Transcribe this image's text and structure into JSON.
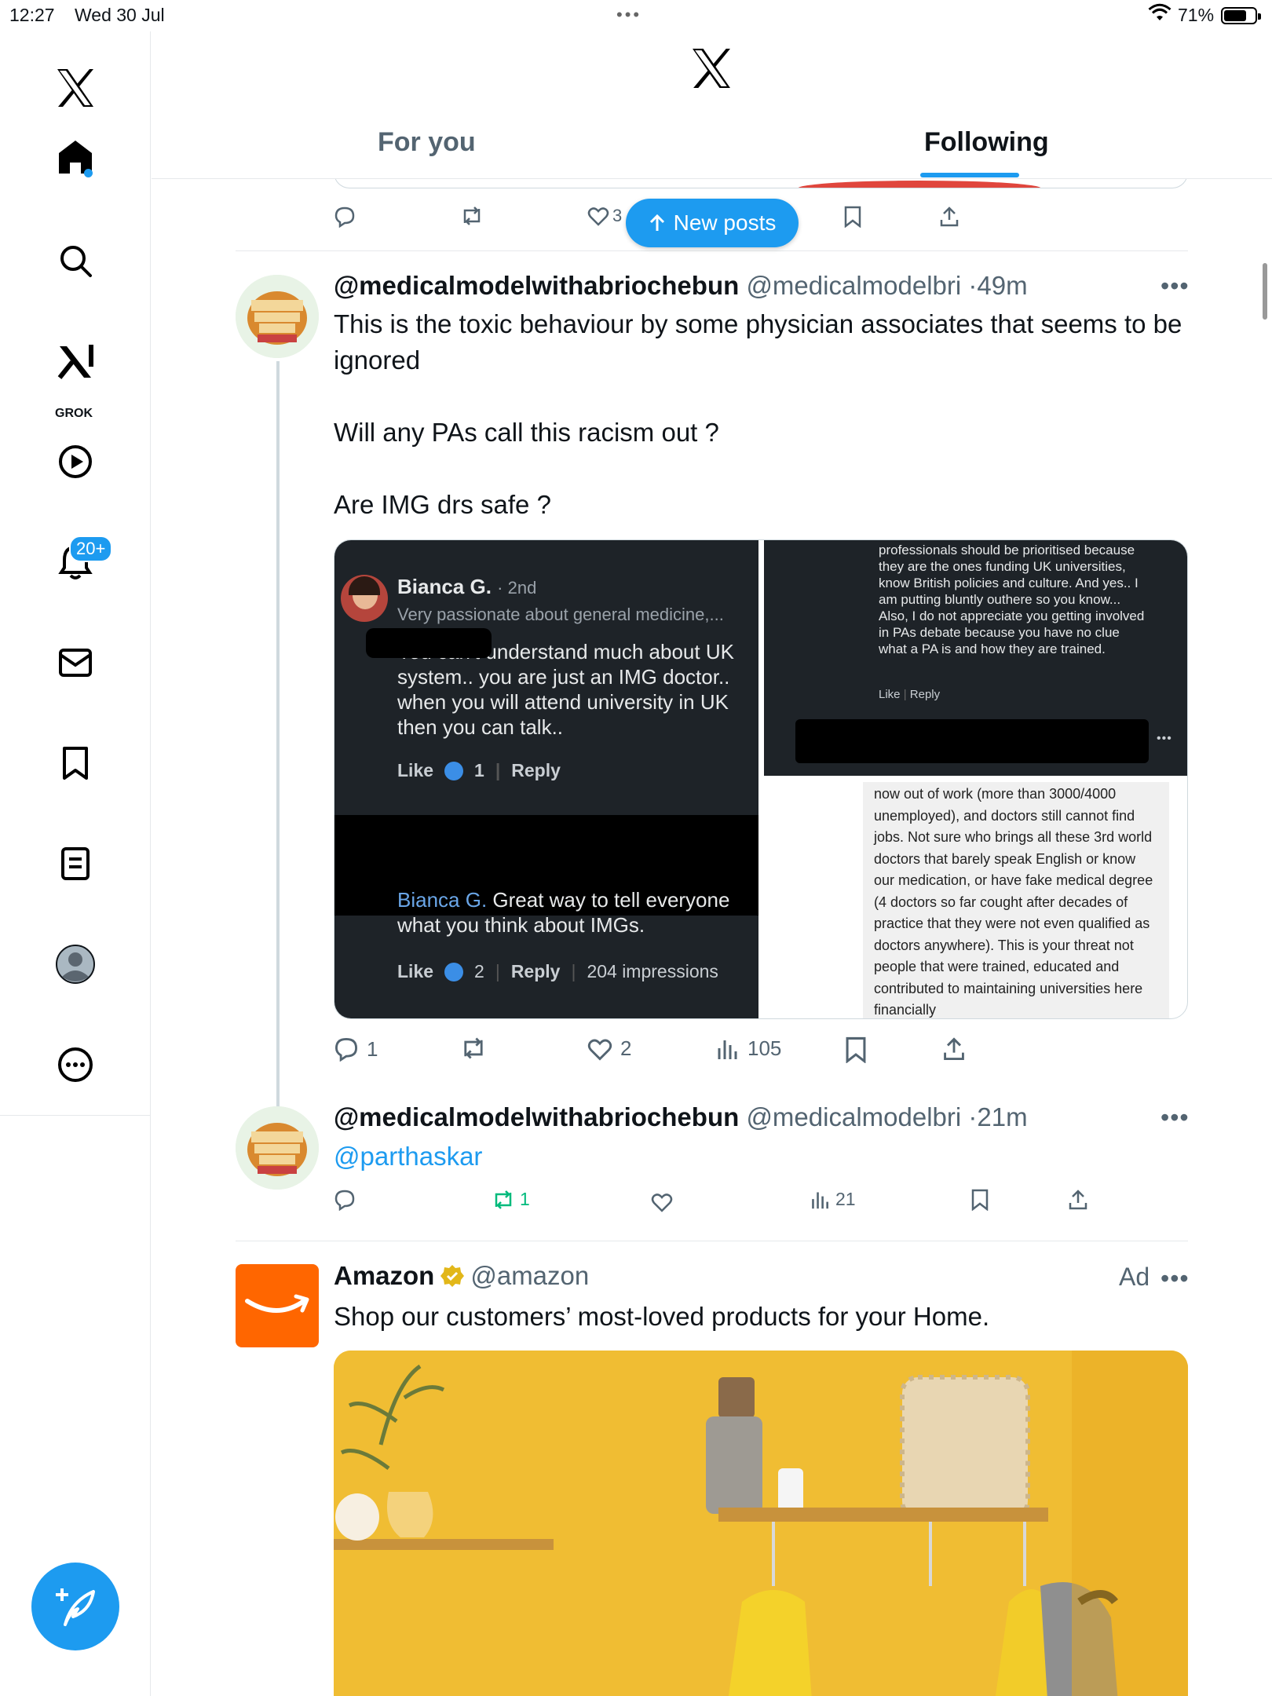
{
  "status_bar": {
    "time": "12:27",
    "date": "Wed 30 Jul",
    "battery": "71%",
    "battery_level": 0.71
  },
  "sidebar": {
    "grok_label": "GROK",
    "notifications_badge": "20+",
    "items": [
      "x-logo",
      "home",
      "search",
      "grok",
      "video",
      "notifications",
      "messages",
      "bookmarks",
      "lists",
      "profile",
      "more"
    ]
  },
  "header": {
    "tabs": [
      {
        "label": "For you",
        "active": false
      },
      {
        "label": "Following",
        "active": true
      }
    ]
  },
  "prev_post": {
    "like_count": "3"
  },
  "new_posts_label": "New posts",
  "posts": [
    {
      "name": "@medicalmodelwithabriochebun",
      "handle": "@medicalmodelbri",
      "time": "49m",
      "lines": [
        "This is the toxic behaviour by some physician associates that seems to be ignored",
        "Will any PAs call this racism out ?",
        "Are IMG drs safe ?"
      ],
      "media": {
        "left": {
          "commenter": "Bianca G.",
          "degree": "· 2nd",
          "headline": "Very passionate about general medicine,...",
          "comment1": "You can't understand much about UK system.. you are just an IMG doctor.. when you will attend university in UK then you can talk..",
          "like": "Like",
          "reply": "Reply",
          "count1": "1",
          "reply_name": "Bianca G.",
          "comment2": "Great way to tell everyone what you think about IMGs.",
          "count2": "2",
          "impressions": "204 impressions"
        },
        "right_top": {
          "text": "professionals should be prioritised because they are the ones funding UK universities, know British policies and culture. And yes.. I am putting bluntly outhere so you know... Also, I do not appreciate you getting involved in PAs debate because you have no clue what a PA is and how they are trained.",
          "like": "Like",
          "reply": "Reply"
        },
        "right_bottom": {
          "text": "now out of work (more than 3000/4000 unemployed), and doctors still cannot find jobs. Not sure who brings all these 3rd world doctors that barely speak English or know our medication, or have fake medical degree (4 doctors so far cought after decades of practice that they were not even qualified as doctors anywhere). This is your threat not people that were trained, educated and contributed to maintaining universities here financially"
        }
      },
      "stats": {
        "replies": "1",
        "reposts": "",
        "likes": "2",
        "views": "105"
      }
    },
    {
      "name": "@medicalmodelwithabriochebun",
      "handle": "@medicalmodelbri",
      "time": "21m",
      "mention": "@parthaskar",
      "stats": {
        "replies": "",
        "reposts": "1",
        "likes": "",
        "views": "21"
      }
    }
  ],
  "ad": {
    "name": "Amazon",
    "handle": "@amazon",
    "label": "Ad",
    "text": "Shop our customers’ most-loved products for your Home."
  },
  "colors": {
    "accent": "#1d9bf0",
    "repost_green": "#00ba7c",
    "amazon_orange": "#ff6600"
  }
}
